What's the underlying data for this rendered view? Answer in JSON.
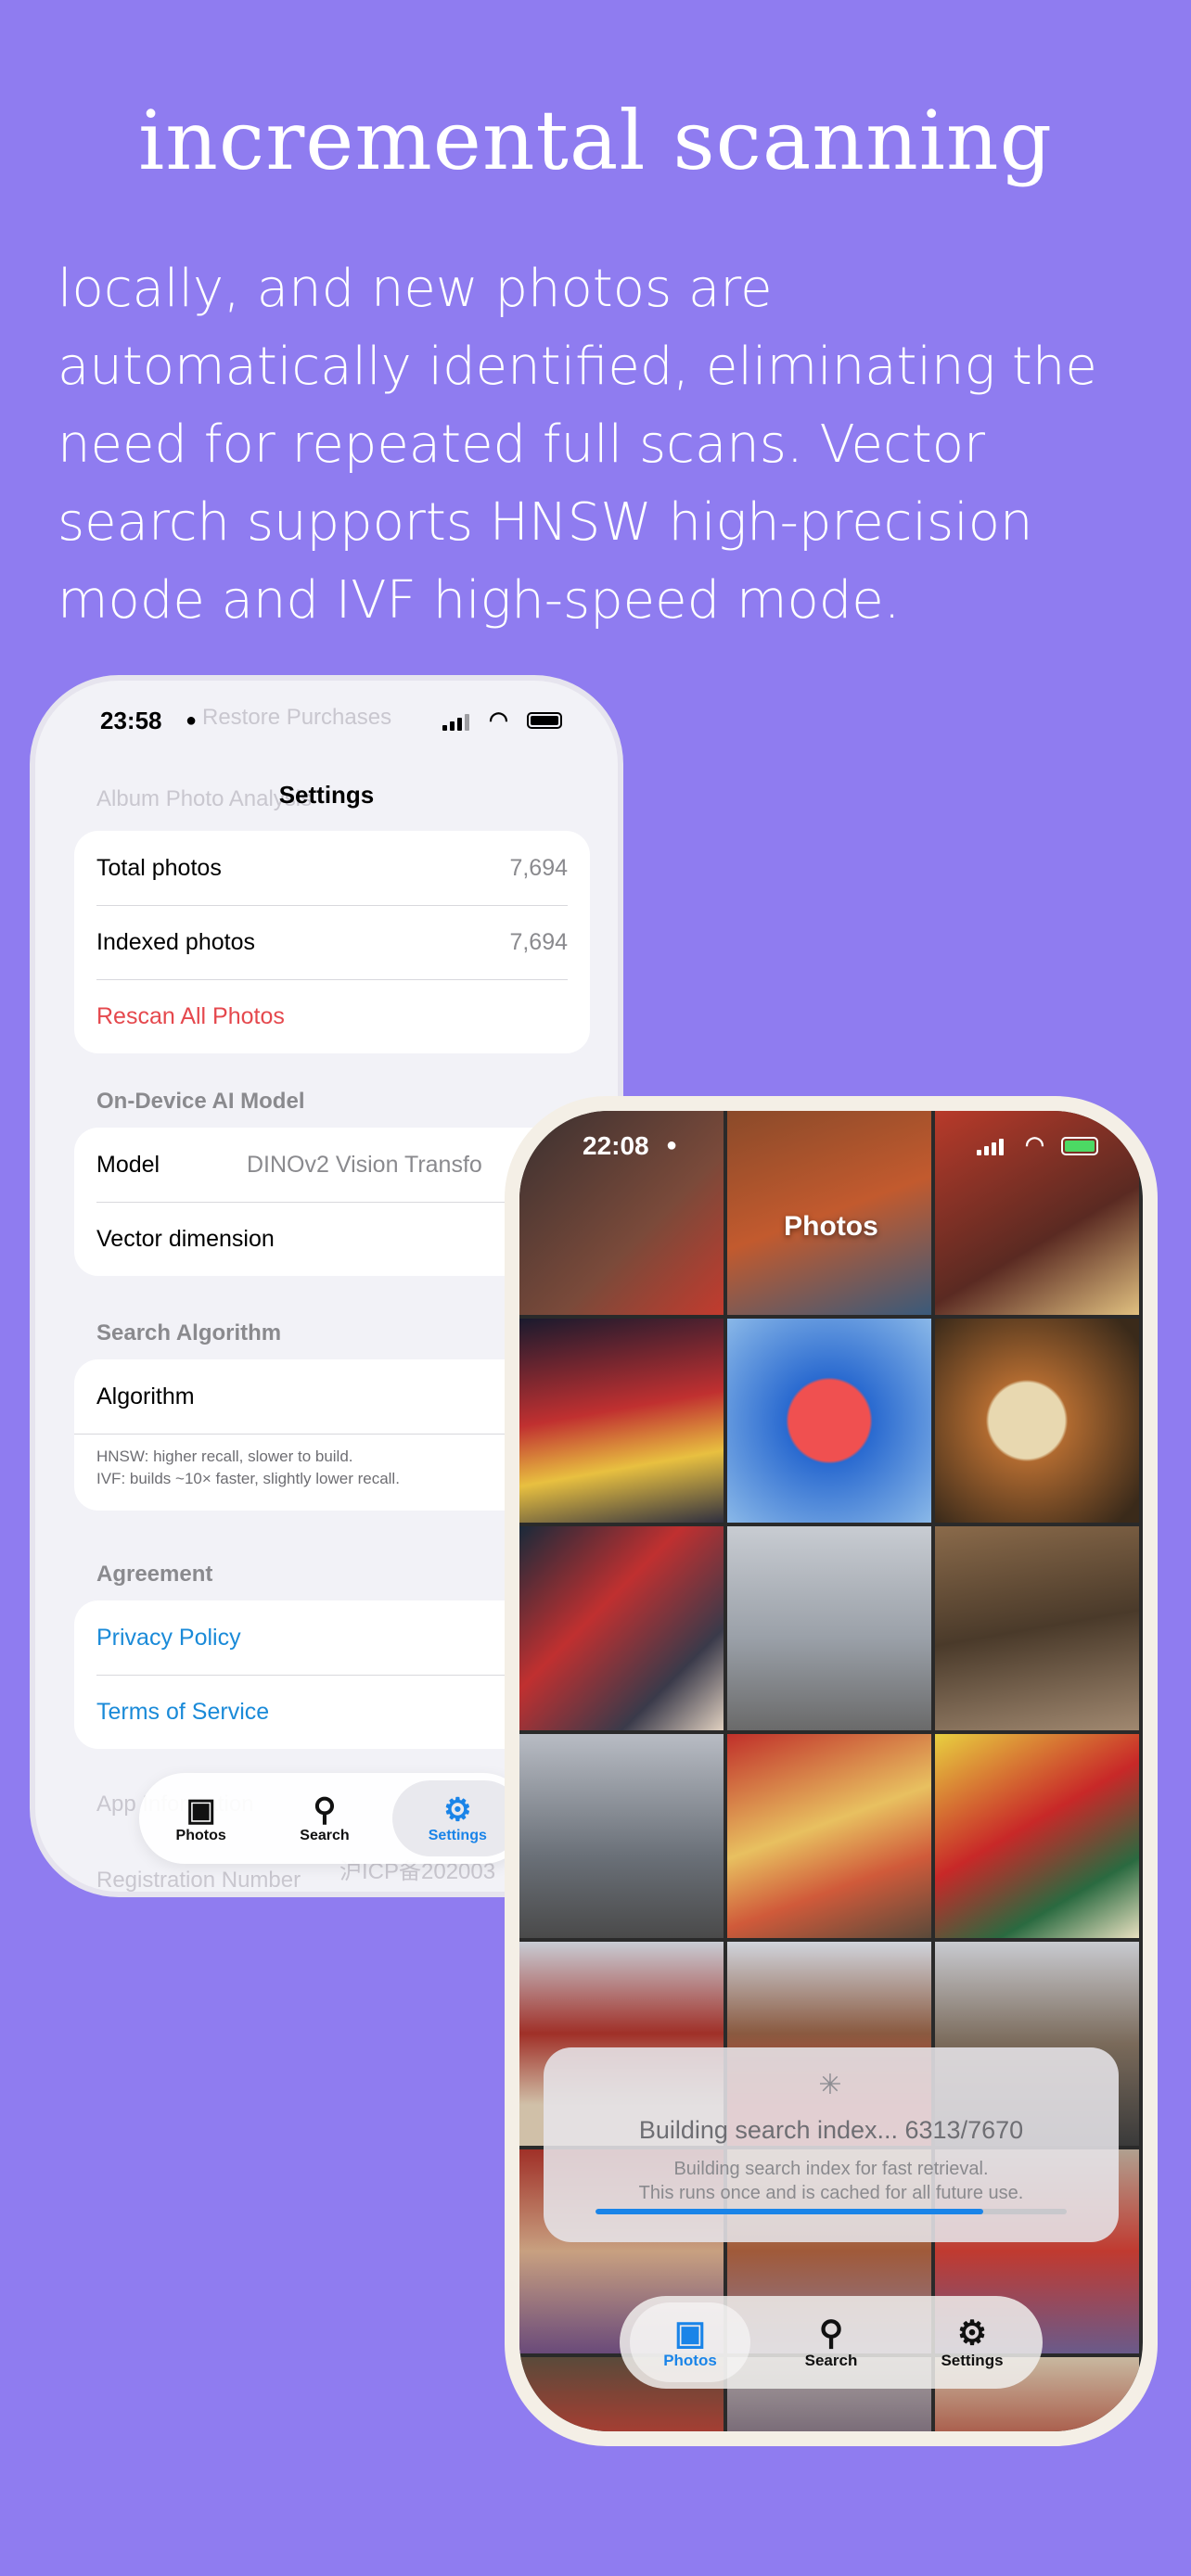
{
  "headline": "incremental scanning",
  "description": "locally, and new photos are automatically identified, eliminating the need for repeated full scans. Vector search supports HNSW high-precision mode and IVF high-speed mode.",
  "settings_phone": {
    "status_time": "23:58",
    "ghost_top": "Restore Purchases",
    "ghost_section": "Album Photo Analysis",
    "title": "Settings",
    "stats": {
      "total_label": "Total photos",
      "total_value": "7,694",
      "indexed_label": "Indexed photos",
      "indexed_value": "7,694",
      "rescan_label": "Rescan All Photos"
    },
    "model_section": "On-Device AI Model",
    "model_label": "Model",
    "model_value": "DINOv2 Vision Transfo",
    "vector_label": "Vector dimension",
    "algo_section": "Search Algorithm",
    "algo_label": "Algorithm",
    "algo_note_1": "HNSW: higher recall, slower to build.",
    "algo_note_2": "IVF: builds ~10× faster, slightly lower recall.",
    "agreement_section": "Agreement",
    "privacy_label": "Privacy Policy",
    "terms_label": "Terms of Service",
    "ghost_app_section": "App Information",
    "ghost_registration": "Registration Number",
    "ghost_icp": "沪ICP备202003",
    "tabs": {
      "photos": "Photos",
      "search": "Search",
      "settings": "Settings"
    }
  },
  "photos_phone": {
    "status_time": "22:08",
    "title": "Photos",
    "progress_title": "Building search index... 6313/7670",
    "progress_sub_1": "Building search index for fast retrieval.",
    "progress_sub_2": "This runs once and is cached for all future use.",
    "progress_fraction": 0.823,
    "tabs": {
      "photos": "Photos",
      "search": "Search",
      "settings": "Settings"
    }
  },
  "colors": {
    "background": "#8f7cf0",
    "accent": "#1a84e8",
    "destructive": "#e5484d",
    "link": "#1a8ad8"
  }
}
